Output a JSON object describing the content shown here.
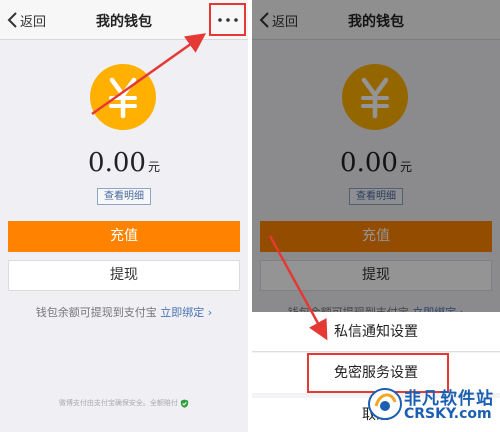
{
  "left_screen": {
    "nav": {
      "back_label": "返回",
      "title": "我的钱包"
    },
    "balance": {
      "amount": "0.00",
      "unit": "元"
    },
    "details_label": "查看明细",
    "recharge_label": "充值",
    "withdraw_label": "提现",
    "hint_text": "钱包余额可提现到支付宝",
    "hint_link": "立即绑定 ›",
    "footer_note": "微博支付由支付宝确保安全。全额赔付"
  },
  "right_screen": {
    "nav": {
      "back_label": "返回",
      "title": "我的钱包"
    },
    "balance": {
      "amount": "0.00",
      "unit": "元"
    },
    "details_label": "查看明细",
    "recharge_label": "充值",
    "withdraw_label": "提现",
    "hint_text": "钱包余额可提现到支付宝",
    "hint_link": "立即绑定 ›",
    "action_sheet": {
      "items": [
        "私信通知设置",
        "免密服务设置"
      ],
      "cancel_label": "取消"
    }
  },
  "watermark": {
    "text": "非凡软件站",
    "sub": "CRSKY.com"
  },
  "colors": {
    "accent": "#ff8300",
    "coin": "#ffb000",
    "highlight": "#e53935",
    "link": "#4a74b4"
  },
  "icons": [
    "chevron-left-icon",
    "more-dots-icon",
    "yuan-coin-icon",
    "shield-check-icon"
  ]
}
